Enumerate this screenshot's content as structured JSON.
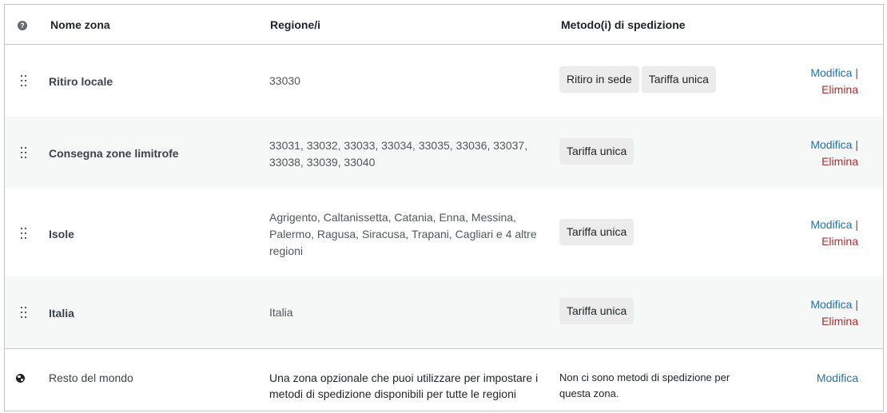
{
  "header": {
    "name": "Nome zona",
    "regions": "Regione/i",
    "methods": "Metodo(i) di spedizione",
    "help_icon": "question-mark-icon"
  },
  "zones": [
    {
      "name": "Ritiro locale",
      "regions": "33030",
      "methods": [
        "Ritiro in sede",
        "Tariffa unica"
      ],
      "edit": "Modifica",
      "delete": "Elimina"
    },
    {
      "name": "Consegna zone limitrofe",
      "regions": "33031, 33032, 33033, 33034, 33035, 33036, 33037, 33038, 33039, 33040",
      "methods": [
        "Tariffa unica"
      ],
      "edit": "Modifica",
      "delete": "Elimina"
    },
    {
      "name": "Isole",
      "regions": "Agrigento, Caltanissetta, Catania, Enna, Messina, Palermo, Ragusa, Siracusa, Trapani, Cagliari e 4 altre regioni",
      "methods": [
        "Tariffa unica"
      ],
      "edit": "Modifica",
      "delete": "Elimina"
    },
    {
      "name": "Italia",
      "regions": "Italia",
      "methods": [
        "Tariffa unica"
      ],
      "edit": "Modifica",
      "delete": "Elimina"
    }
  ],
  "rest_of_world": {
    "name": "Resto del mondo",
    "description": "Una zona opzionale che puoi utilizzare per impostare i metodi di spedizione disponibili per tutte le regioni",
    "methods_text": "Non ci sono metodi di spedizione per questa zona.",
    "edit": "Modifica",
    "icon": "globe-icon"
  },
  "separator": "|",
  "colors": {
    "link": "#2271b1",
    "delete": "#b32d2e",
    "chip_bg": "#ececec",
    "alt_row": "#f6f7f7"
  }
}
